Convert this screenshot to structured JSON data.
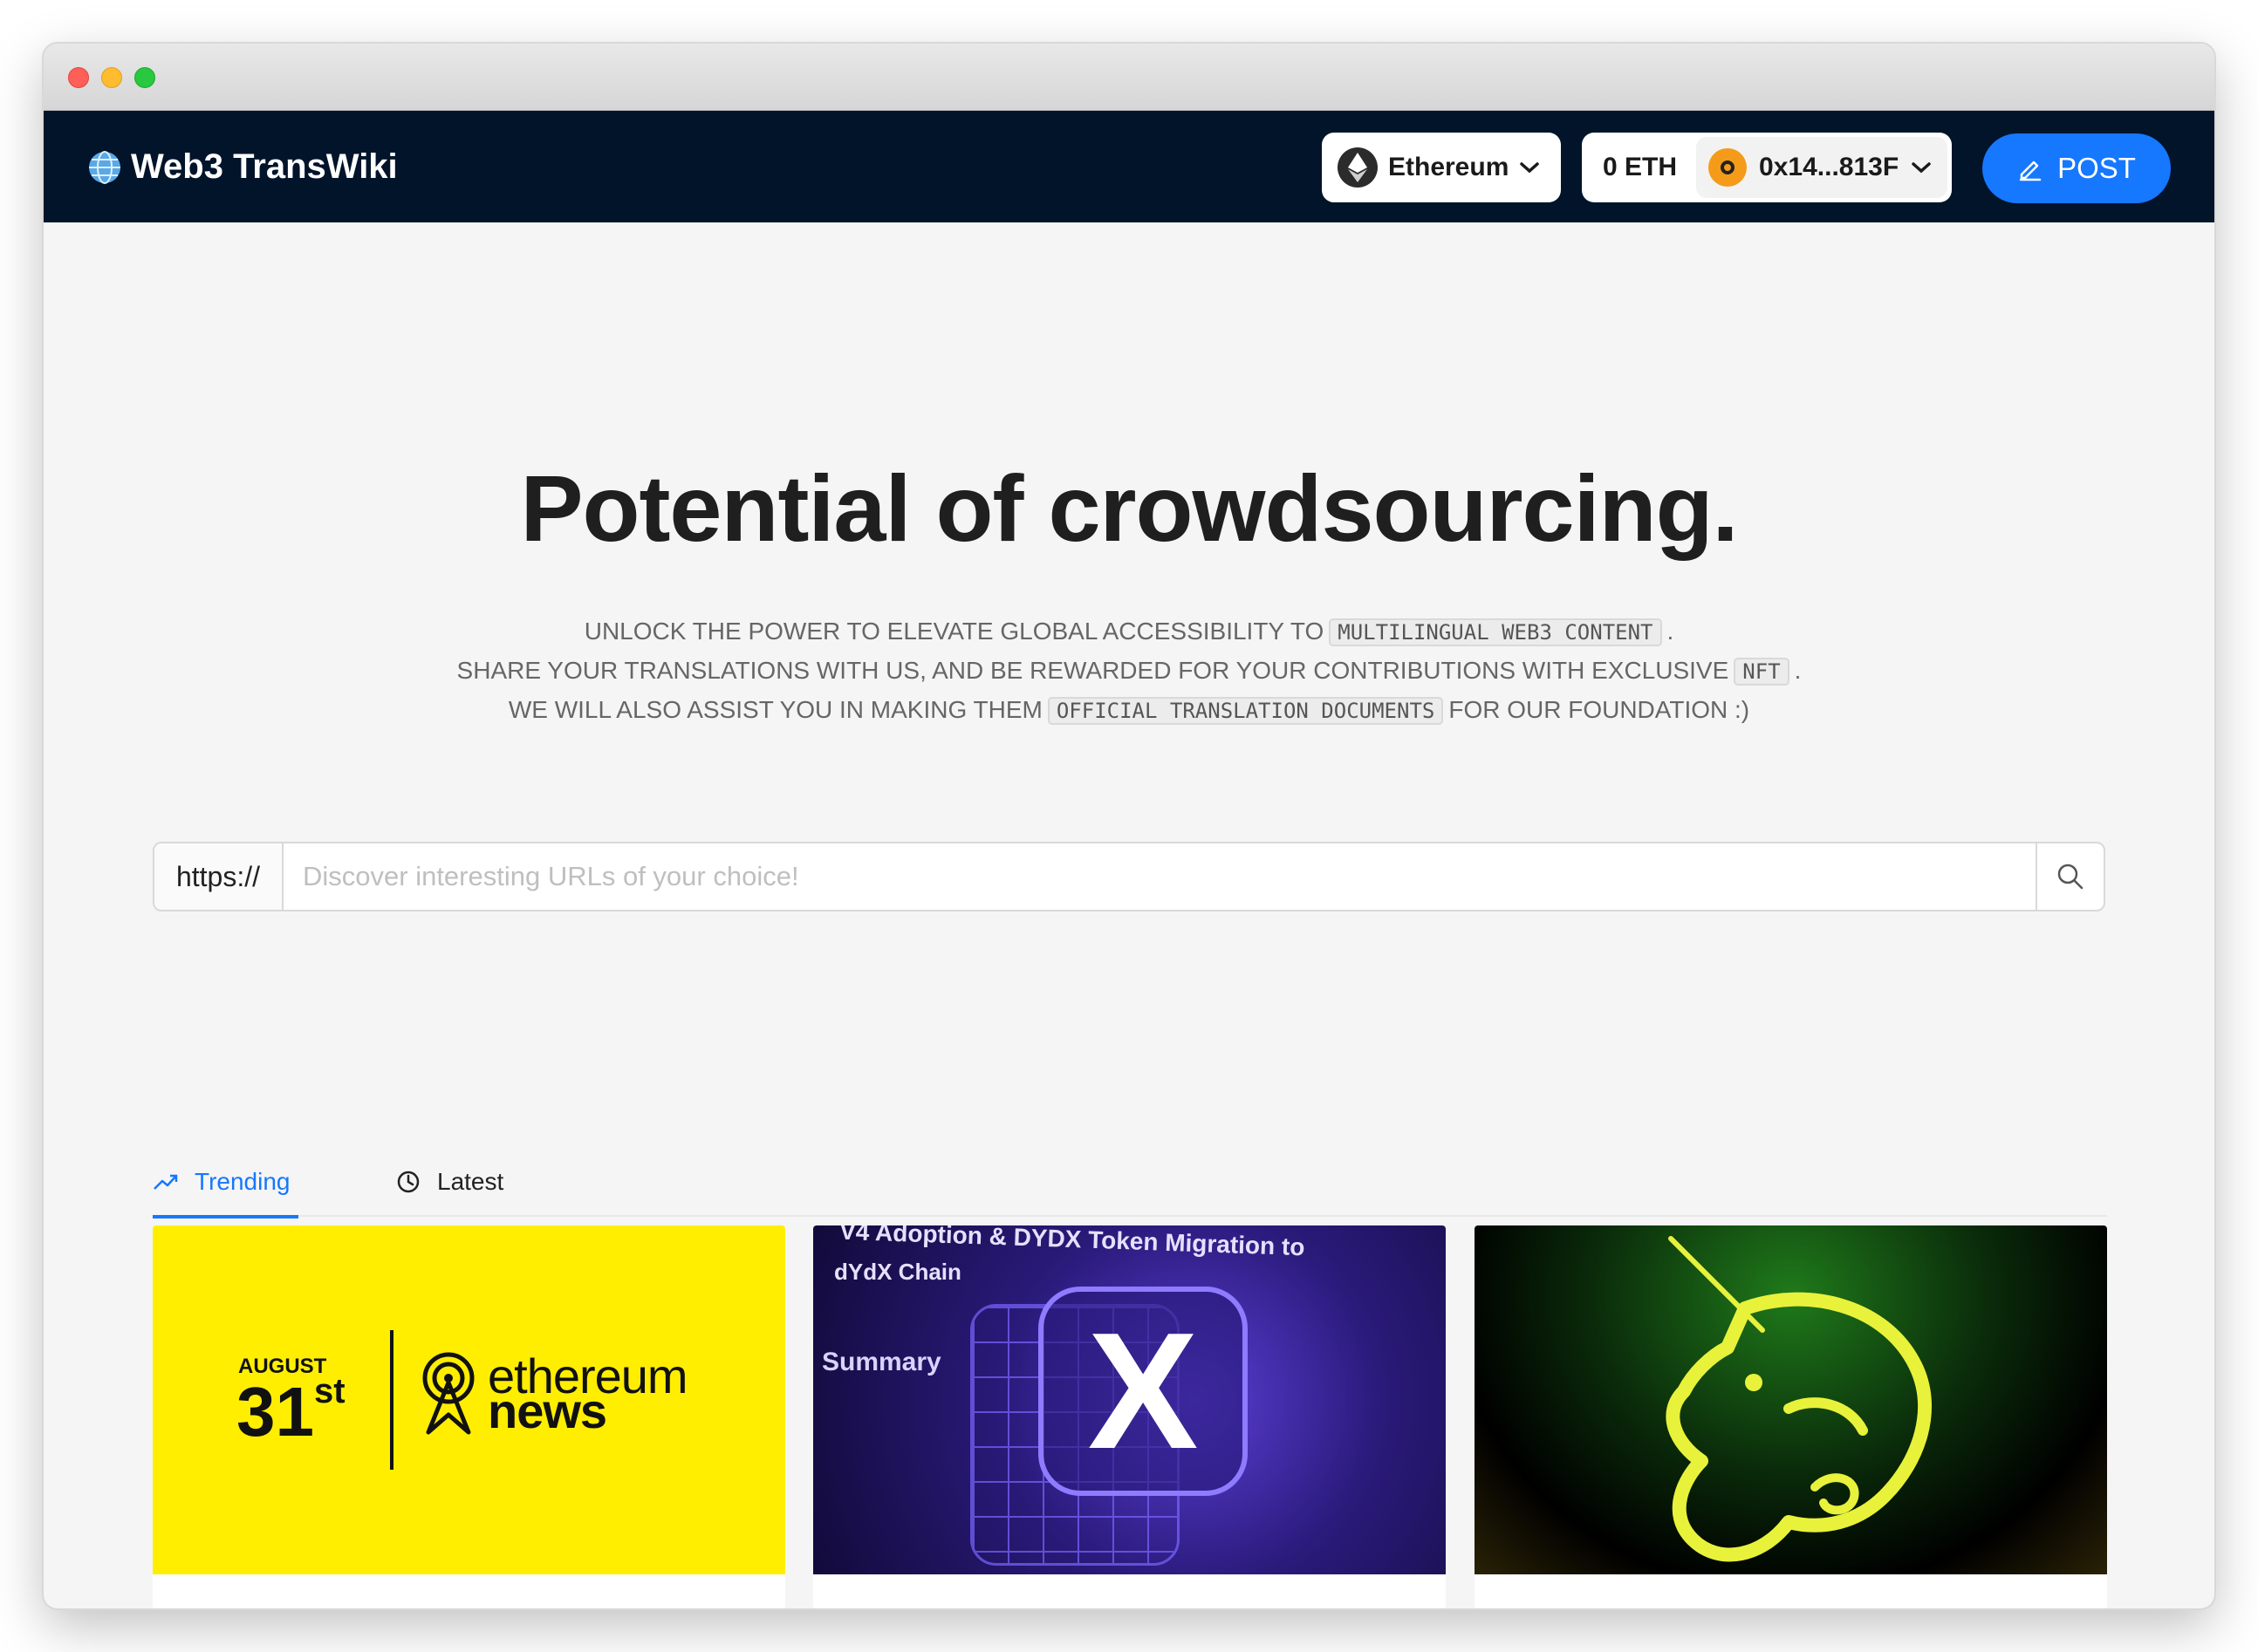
{
  "navbar": {
    "brand": "Web3 TransWiki",
    "network": "Ethereum",
    "balance": "0 ETH",
    "account": "0x14...813F",
    "post_label": "POST"
  },
  "hero": {
    "title": "Potential of crowdsourcing.",
    "line1_pre": "UNLOCK THE POWER TO ELEVATE GLOBAL ACCESSIBILITY TO",
    "line1_code": "MULTILINGUAL WEB3 CONTENT",
    "line1_post": ".",
    "line2_pre": "SHARE YOUR TRANSLATIONS WITH US, AND BE REWARDED FOR YOUR CONTRIBUTIONS WITH EXCLUSIVE",
    "line2_code": "NFT",
    "line2_post": ".",
    "line3_pre": "WE WILL ALSO ASSIST YOU IN MAKING THEM",
    "line3_code": "OFFICIAL TRANSLATION DOCUMENTS",
    "line3_post": "FOR OUR FOUNDATION :)"
  },
  "search": {
    "prefix": "https://",
    "placeholder": "Discover interesting URLs of your choice!",
    "value": ""
  },
  "tabs": [
    {
      "label": "Trending",
      "icon": "trending-up-icon",
      "active": true
    },
    {
      "label": "Latest",
      "icon": "clock-icon",
      "active": false
    }
  ],
  "cards": [
    {
      "month": "AUGUST",
      "day": "31",
      "day_suffix": "st",
      "brand_line1": "ethereum",
      "brand_line2": "news"
    },
    {
      "heading1": "V4 Adoption & DYDX Token Migration to",
      "heading2": "dYdX Chain",
      "summary": "Summary",
      "logo_letter": "X"
    },
    {
      "subject": "unicorn-logo"
    }
  ],
  "colors": {
    "navbar_bg": "#01142a",
    "accent": "#1677ff",
    "card1_bg": "#ffee00"
  }
}
